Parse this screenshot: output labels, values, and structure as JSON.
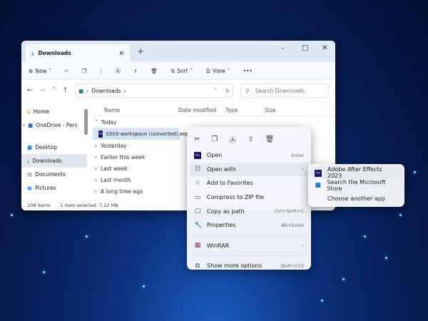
{
  "window": {
    "tab_title": "Downloads",
    "tab_close": "×",
    "new_tab": "+",
    "minimize": "–",
    "maximize": "□",
    "close": "✕"
  },
  "toolbar": {
    "new": "New",
    "sort": "Sort",
    "view": "View",
    "more": "•••"
  },
  "address": {
    "path": "Downloads",
    "search_placeholder": "Search Downloads"
  },
  "sidebar": {
    "items": [
      {
        "label": "Home"
      },
      {
        "label": "OneDrive - Pers"
      },
      {
        "label": "Desktop"
      },
      {
        "label": "Downloads"
      },
      {
        "label": "Documents"
      },
      {
        "label": "Pictures"
      }
    ]
  },
  "columns": [
    "Name",
    "Date modified",
    "Type",
    "Size"
  ],
  "groups": [
    "Today",
    "Yesterday",
    "Earlier this week",
    "Last week",
    "Last month",
    "A long time ago"
  ],
  "file": {
    "name": "0203-workspace (converted).aep"
  },
  "status": {
    "items": "108 items",
    "selected": "1 item selected",
    "size": "7.12 MB"
  },
  "context_menu": {
    "items": [
      {
        "label": "Open",
        "shortcut": "Enter"
      },
      {
        "label": "Open with",
        "arrow": "›"
      },
      {
        "label": "Add to Favorites"
      },
      {
        "label": "Compress to ZIP file"
      },
      {
        "label": "Copy as path",
        "shortcut": "Ctrl+Shift+C"
      },
      {
        "label": "Properties",
        "shortcut": "Alt+Enter"
      },
      {
        "label": "WinRAR",
        "arrow": "›"
      },
      {
        "label": "Show more options",
        "shortcut": "Shift+F10"
      }
    ]
  },
  "submenu": {
    "items": [
      {
        "label": "Adobe After Effects 2023"
      },
      {
        "label": "Search the Microsoft Store"
      },
      {
        "label": "Choose another app"
      }
    ]
  },
  "ae_badge": "Ae"
}
